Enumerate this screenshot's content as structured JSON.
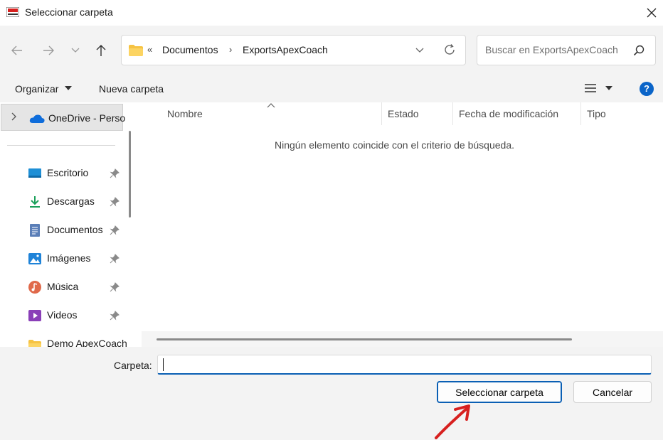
{
  "window": {
    "title": "Seleccionar carpeta"
  },
  "address": {
    "overflow": "«",
    "crumbs": [
      "Documentos",
      "ExportsApexCoach"
    ],
    "separator": "›"
  },
  "search": {
    "placeholder": "Buscar en ExportsApexCoach"
  },
  "commands": {
    "organize": "Organizar",
    "new_folder": "Nueva carpeta",
    "help": "?"
  },
  "sidebar": {
    "onedrive": "OneDrive - Perso",
    "items": [
      {
        "label": "Escritorio",
        "icon": "desktop-icon",
        "pinned": true
      },
      {
        "label": "Descargas",
        "icon": "download-icon",
        "pinned": true
      },
      {
        "label": "Documentos",
        "icon": "document-icon",
        "pinned": true
      },
      {
        "label": "Imágenes",
        "icon": "pictures-icon",
        "pinned": true
      },
      {
        "label": "Música",
        "icon": "music-icon",
        "pinned": true
      },
      {
        "label": "Videos",
        "icon": "video-icon",
        "pinned": true
      },
      {
        "label": "Demo ApexCoach",
        "icon": "folder-icon",
        "pinned": false
      }
    ]
  },
  "filelist": {
    "columns": [
      "Nombre",
      "Estado",
      "Fecha de modificación",
      "Tipo"
    ],
    "empty_message": "Ningún elemento coincide con el criterio de búsqueda."
  },
  "footer": {
    "folder_label": "Carpeta:",
    "folder_value": "",
    "select_button": "Seleccionar carpeta",
    "cancel_button": "Cancelar"
  },
  "colors": {
    "accent": "#0a5fb4",
    "annotation_arrow": "#d7201f"
  }
}
